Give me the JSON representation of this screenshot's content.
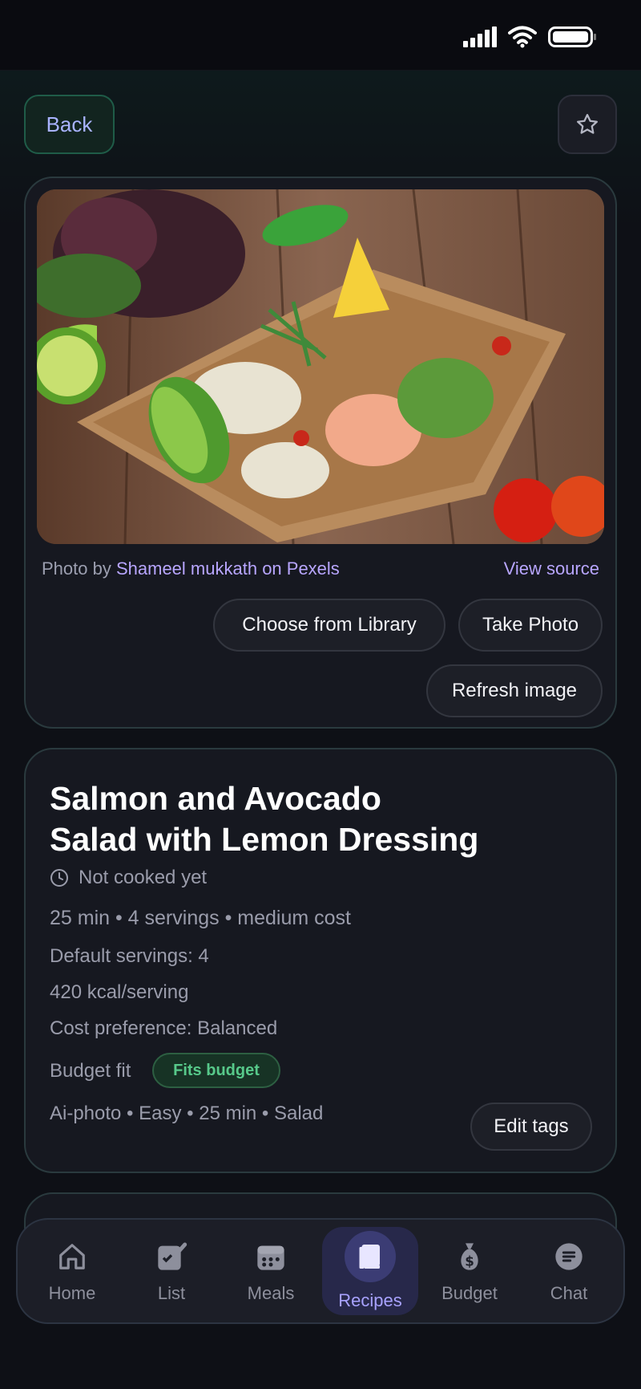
{
  "header": {
    "back_label": "Back"
  },
  "photo": {
    "credit_prefix": "Photo by",
    "photographer": "Shameel mukkath",
    "credit_suffix": "on Pexels",
    "view_source": "View source",
    "choose_library": "Choose from Library",
    "take_photo": "Take Photo",
    "refresh": "Refresh image"
  },
  "recipe": {
    "title_line1": "Salmon and Avocado",
    "title_line2": "Salad with Lemon Dressing",
    "cooked_status": "Not cooked yet",
    "summary": "25 min • 4 servings • medium cost",
    "default_servings": "Default servings: 4",
    "calories": "420 kcal/serving",
    "cost_preference": "Cost preference: Balanced",
    "budget_fit_label": "Budget fit",
    "budget_badge": "Fits budget",
    "tags": "Ai-photo • Easy • 25 min • Salad",
    "edit_tags": "Edit tags"
  },
  "tabs": [
    {
      "label": "Home",
      "icon": "home-icon"
    },
    {
      "label": "List",
      "icon": "list-icon"
    },
    {
      "label": "Meals",
      "icon": "calendar-icon"
    },
    {
      "label": "Recipes",
      "icon": "book-icon",
      "active": true
    },
    {
      "label": "Budget",
      "icon": "money-bag-icon"
    },
    {
      "label": "Chat",
      "icon": "chat-icon"
    }
  ],
  "colors": {
    "accent": "#a8a2ff",
    "link": "#b8a6ff",
    "success": "#57c98a"
  }
}
